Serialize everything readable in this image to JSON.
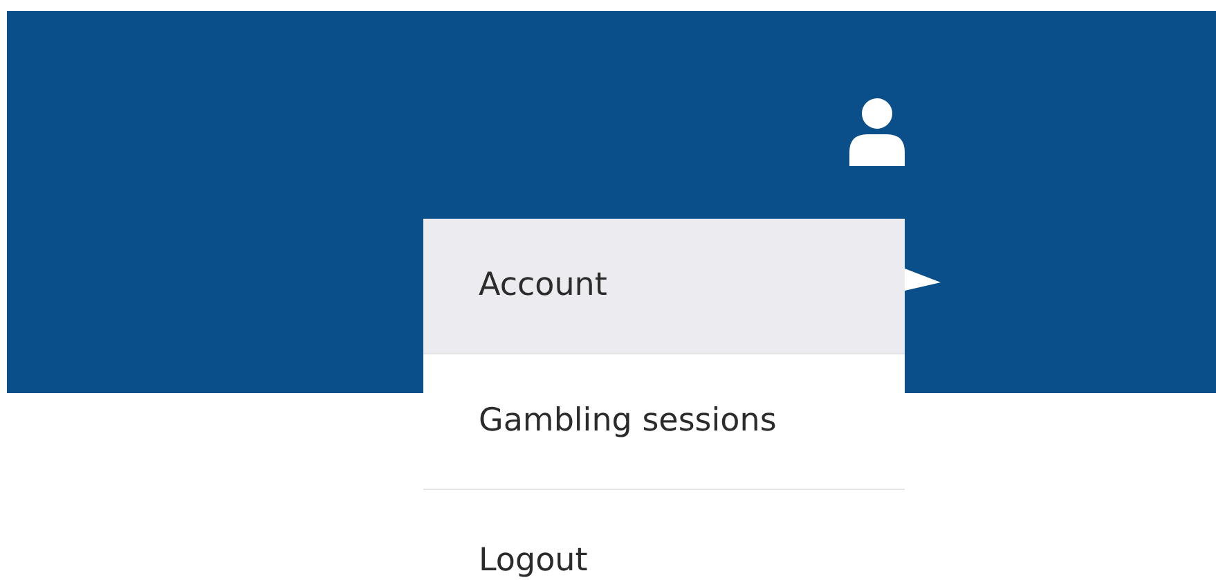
{
  "menu": {
    "items": [
      {
        "label": "Account",
        "selected": true
      },
      {
        "label": "Gambling sessions",
        "selected": false
      },
      {
        "label": "Logout",
        "selected": false
      }
    ]
  }
}
